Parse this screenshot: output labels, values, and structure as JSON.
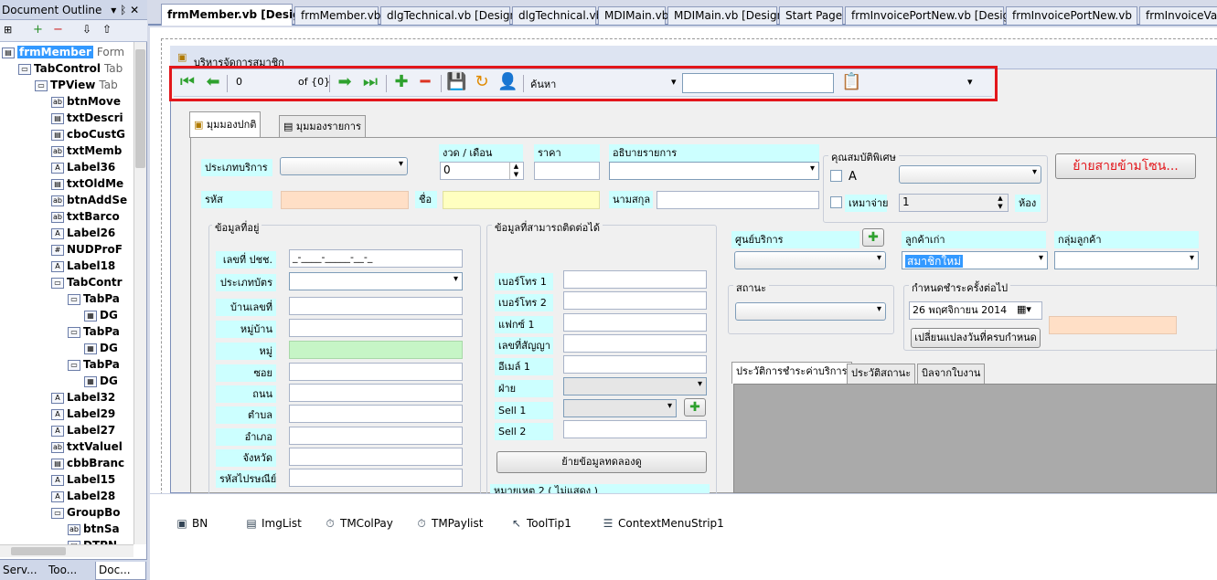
{
  "left_panel": {
    "title": "Document Outline",
    "header_tail": "▾ ᛒ ✕",
    "tree": [
      {
        "label": "frmMember",
        "type": "Form",
        "selected": true
      },
      {
        "label": "TabControl",
        "type": "Tab"
      },
      {
        "label": "TPView",
        "type": "Tab"
      },
      {
        "label": "btnMove",
        "type": ""
      },
      {
        "label": "txtDescri",
        "type": ""
      },
      {
        "label": "cboCustG",
        "type": ""
      },
      {
        "label": "txtMemb",
        "type": ""
      },
      {
        "label": "Label36",
        "type": ""
      },
      {
        "label": "txtOldMe",
        "type": ""
      },
      {
        "label": "btnAddSe",
        "type": ""
      },
      {
        "label": "txtBarco",
        "type": ""
      },
      {
        "label": "Label26",
        "type": ""
      },
      {
        "label": "NUDProF",
        "type": ""
      },
      {
        "label": "Label18",
        "type": ""
      },
      {
        "label": "TabContr",
        "type": ""
      },
      {
        "label": "TabPa",
        "type": ""
      },
      {
        "label": "DG",
        "type": ""
      },
      {
        "label": "TabPa",
        "type": ""
      },
      {
        "label": "DG",
        "type": ""
      },
      {
        "label": "TabPa",
        "type": ""
      },
      {
        "label": "DG",
        "type": ""
      },
      {
        "label": "Label32",
        "type": ""
      },
      {
        "label": "Label29",
        "type": ""
      },
      {
        "label": "Label27",
        "type": ""
      },
      {
        "label": "txtValuel",
        "type": ""
      },
      {
        "label": "cbbBranc",
        "type": ""
      },
      {
        "label": "Label15",
        "type": ""
      },
      {
        "label": "Label28",
        "type": ""
      },
      {
        "label": "GroupBo",
        "type": ""
      },
      {
        "label": "btnSa",
        "type": ""
      },
      {
        "label": "DTPN",
        "type": ""
      }
    ],
    "bottom_tabs": [
      "Serv...",
      "Too...",
      "Doc..."
    ]
  },
  "doc_tabs": [
    "frmMember.vb [Design]",
    "frmMember.vb",
    "dlgTechnical.vb [Design]",
    "dlgTechnical.vb",
    "MDIMain.vb",
    "MDIMain.vb [Design]",
    "Start Page",
    "frmInvoicePortNew.vb [Design]",
    "frmInvoicePortNew.vb",
    "frmInvoiceVatP"
  ],
  "form": {
    "title": "บริหารจัดการสมาชิก",
    "toolbar": {
      "position": "0",
      "count": "of {0}",
      "search_label": "ค้นหา",
      "search_value": ""
    },
    "tabs": [
      "มุมมองปกติ",
      "มุมมองรายการ"
    ],
    "labels": {
      "service_type": "ประเภทบริการ",
      "term": "งวด / เดือน",
      "price": "ราคา",
      "description": "อธิบายรายการ",
      "special": "คุณสมบัติพิเศษ",
      "code": "รหัส",
      "name": "ชื่อ",
      "surname": "นามสกุล",
      "checkA": "A",
      "flat_rate": "เหมาจ่าย",
      "room": "ห้อง",
      "address_group": "ข้อมูลที่อยู่",
      "contact_group": "ข้อมูลที่สามารถติดต่อได้",
      "service_center": "ศูนย์บริการ",
      "old_customer": "ลูกค้าเก่า",
      "customer_group": "กลุ่มลูกค้า",
      "status": "สถานะ",
      "next_due": "กำหนดชำระครั้งต่อไป"
    },
    "term_value": "0",
    "flat_rate_value": "1",
    "move_zone_btn": "ย้ายสายข้ามโซน...",
    "address_labels": [
      "เลขที่ ปชช.",
      "ประเภทบัตร",
      "บ้านเลขที่",
      "หมู่บ้าน",
      "หมู่",
      "ซอย",
      "ถนน",
      "ตำบล",
      "อำเภอ",
      "จังหวัด",
      "รหัสไปรษณีย์"
    ],
    "id_mask": "_-____-_____-__-_",
    "contact_labels": [
      "เบอร์โทร 1",
      "เบอร์โทร 2",
      "แฟกซ์ 1",
      "เลขที่สัญญา",
      "อีเมล์ 1",
      "ฝ่าย",
      "Sell 1",
      "Sell 2"
    ],
    "move_data_btn": "ย้ายข้อมูลทดลองดู",
    "note_label": "หมายเหตุ 2 ( ไม่แสดง )",
    "old_customer_value": "สมาชิกใหม่",
    "date_value": "26 พฤศจิกายน 2014",
    "change_date_btn": "เปลี่ยนแปลงวันที่ครบกำหนด",
    "history_tabs": [
      "ประวัติการชำระค่าบริการ",
      "ประวัติสถานะ",
      "บิลจากใบงาน"
    ]
  },
  "tray": [
    "BN",
    "ImgList",
    "TMColPay",
    "TMPaylist",
    "ToolTip1",
    "ContextMenuStrip1"
  ],
  "colors": {
    "red_box": "#e3161b",
    "label_bg": "#ccffff",
    "peach": "#ffdfc6",
    "yellow": "#ffffc0",
    "green": "#c6f5c6",
    "selected": "#3399ff"
  }
}
